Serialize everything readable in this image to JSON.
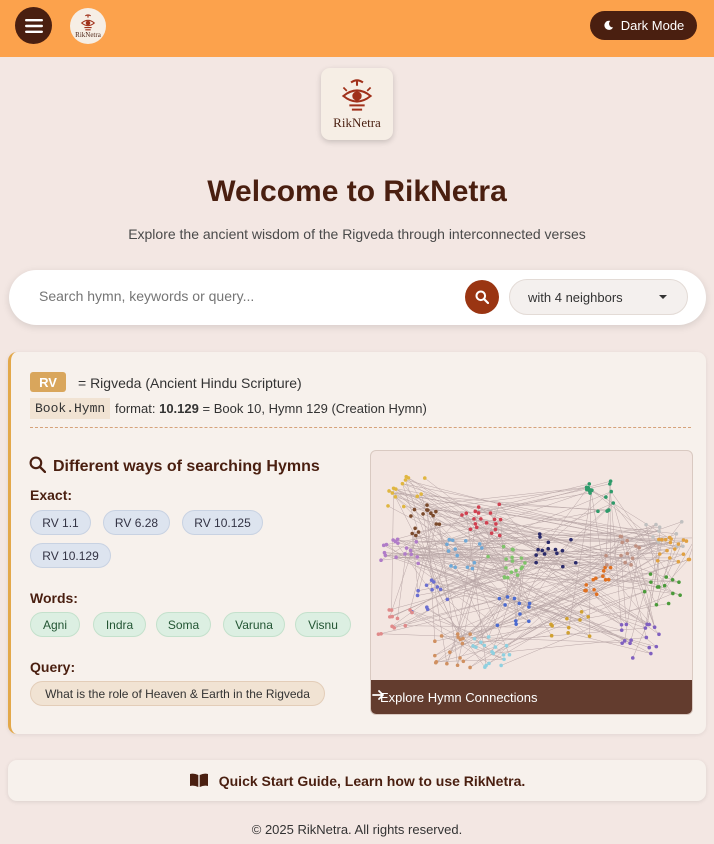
{
  "header": {
    "brand_small": "RikNetra",
    "dark_mode_label": "Dark Mode"
  },
  "logo": {
    "brand_name": "RikNetra"
  },
  "hero": {
    "title": "Welcome to RikNetra",
    "subtitle": "Explore the ancient wisdom of the Rigveda through interconnected verses"
  },
  "search": {
    "placeholder": "Search hymn, keywords or query...",
    "neighbors_selected": "with 4 neighbors"
  },
  "info": {
    "rv_badge": "RV",
    "rv_desc": "= Rigveda (Ancient Hindu Scripture)",
    "format_code": "Book.Hymn",
    "format_prefix": "format:",
    "format_example": "10.129",
    "format_suffix": "= Book 10, Hymn 129 (Creation Hymn)"
  },
  "ways": {
    "title": "Different ways of searching Hymns",
    "exact_label": "Exact:",
    "exact": [
      "RV 1.1",
      "RV 6.28",
      "RV 10.125",
      "RV 10.129"
    ],
    "words_label": "Words:",
    "words": [
      "Agni",
      "Indra",
      "Soma",
      "Varuna",
      "Visnu"
    ],
    "query_label": "Query:",
    "query": "What is the role of Heaven & Earth in the Rigveda"
  },
  "graph": {
    "caption": "Explore Hymn Connections"
  },
  "guide": {
    "label": "Quick Start Guide, Learn how to use RikNetra."
  },
  "footer": {
    "text": "© 2025 RikNetra. All rights reserved."
  },
  "colors": {
    "header_bg": "#fca24c",
    "brand_dark": "#4a1f10",
    "accent": "#9a3512",
    "page_bg": "#f3e7e3"
  }
}
